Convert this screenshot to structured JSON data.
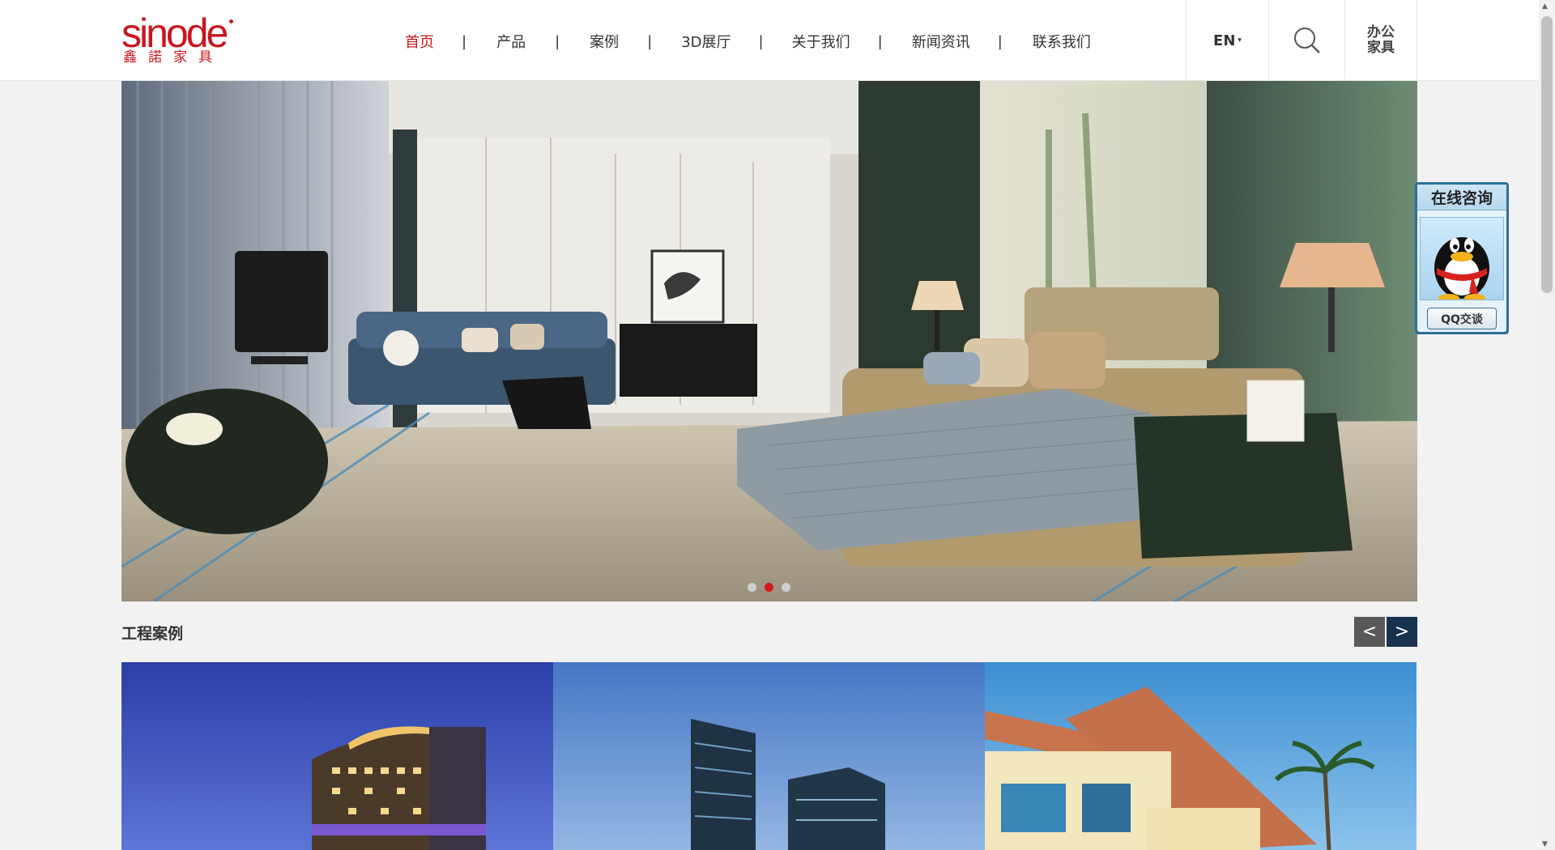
{
  "logo": {
    "text": "sinode",
    "sub": "鑫諾家具"
  },
  "nav": {
    "items": [
      "首页",
      "产品",
      "案例",
      "3D展厅",
      "关于我们",
      "新闻资讯",
      "联系我们"
    ],
    "separator": "|"
  },
  "header": {
    "lang": "EN",
    "lang_caret": "▾",
    "office_line1": "办公",
    "office_line2": "家具"
  },
  "banner": {
    "slides": 3,
    "active_index": 1
  },
  "section": {
    "title": "工程案例",
    "prev": "<",
    "next": ">"
  },
  "qq": {
    "title": "在线咨询",
    "button": "QQ交谈"
  },
  "colors": {
    "brand": "#c7161e",
    "nav_active": "#c7161e",
    "arrow_prev": "#595959",
    "arrow_next": "#17324f"
  }
}
